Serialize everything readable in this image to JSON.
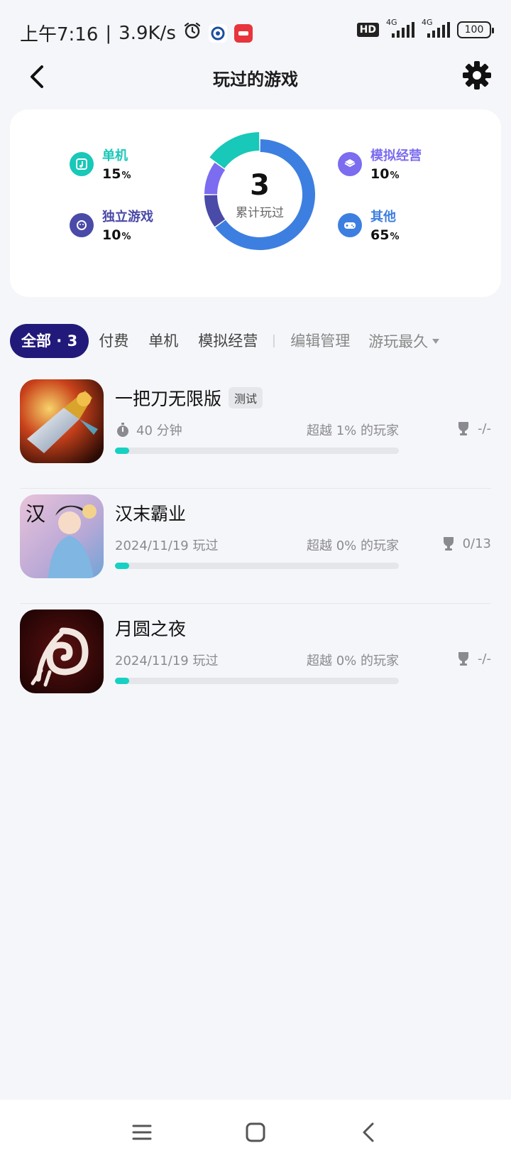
{
  "status": {
    "time": "上午7:16",
    "separator": "|",
    "speed": "3.9K/s",
    "hd": "HD",
    "net1": "4G",
    "net2": "4G",
    "battery": "100"
  },
  "header": {
    "title": "玩过的游戏"
  },
  "stats": {
    "total": "3",
    "total_label": "累计玩过",
    "categories": [
      {
        "name": "单机",
        "percent": "15",
        "unit": "%",
        "color": "#18c8b8",
        "value": 15
      },
      {
        "name": "独立游戏",
        "percent": "10",
        "unit": "%",
        "color": "#4a4aa8",
        "value": 10
      },
      {
        "name": "模拟经营",
        "percent": "10",
        "unit": "%",
        "color": "#7b6cf0",
        "value": 10
      },
      {
        "name": "其他",
        "percent": "65",
        "unit": "%",
        "color": "#3d7fe0",
        "value": 65
      }
    ]
  },
  "tabs": {
    "all": "全部 · 3",
    "paid": "付费",
    "single": "单机",
    "sim": "模拟经营",
    "edit": "编辑管理",
    "sort": "游玩最久"
  },
  "games": [
    {
      "name": "一把刀无限版",
      "tag": "测试",
      "play_info": "40 分钟",
      "rank": "超越 1% 的玩家",
      "achievements": "-/-",
      "progress": 0.05
    },
    {
      "name": "汉末霸业",
      "play_info": "2024/11/19 玩过",
      "rank": "超越 0% 的玩家",
      "achievements": "0/13",
      "progress": 0.05,
      "icon_char": "汉"
    },
    {
      "name": "月圆之夜",
      "play_info": "2024/11/19 玩过",
      "rank": "超越 0% 的玩家",
      "achievements": "-/-",
      "progress": 0.05
    }
  ]
}
